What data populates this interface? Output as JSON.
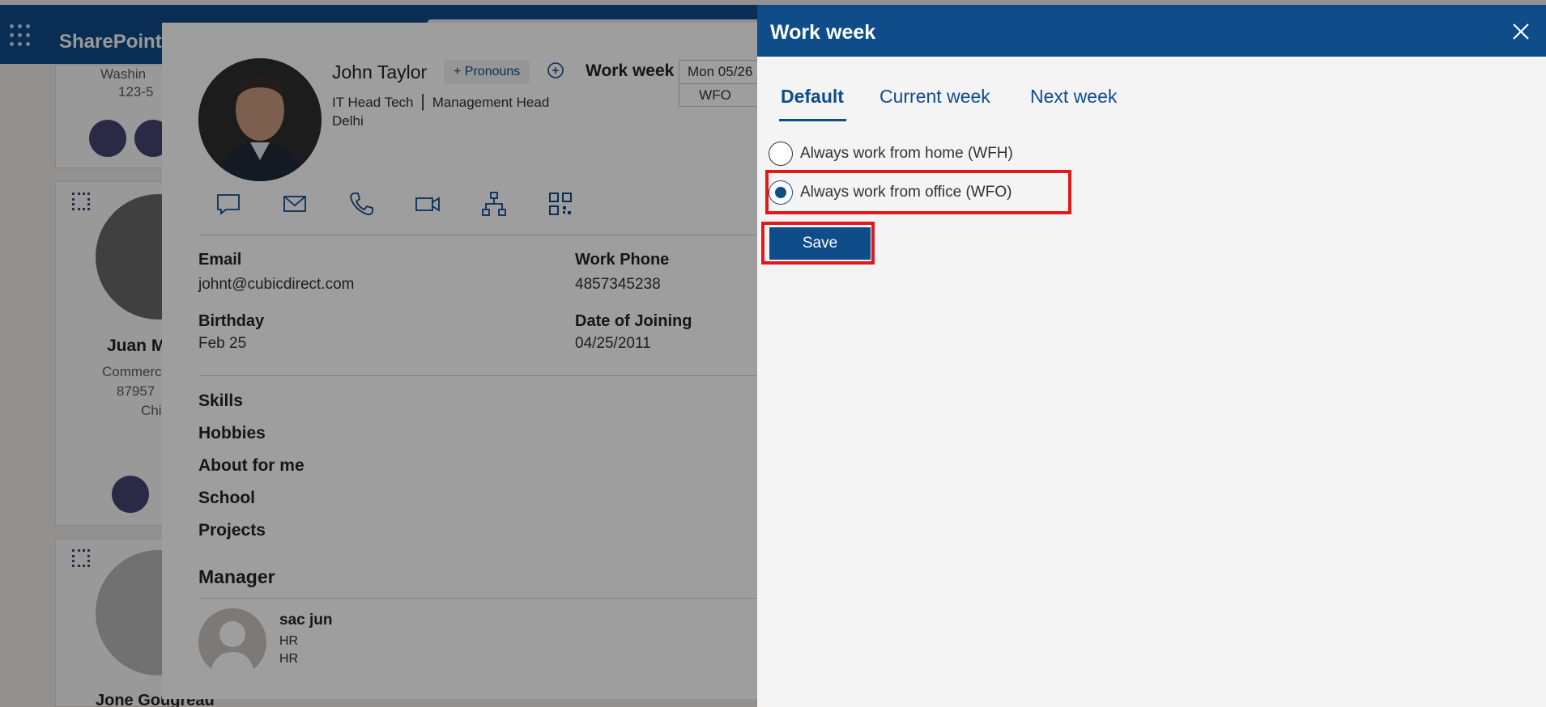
{
  "topbar": {
    "brand": "SharePoint"
  },
  "background_cards": {
    "card1": {
      "location": "Washin",
      "phone": "123-5"
    },
    "card2": {
      "name": "Juan M",
      "dept": "Commerc",
      "phone": "87957",
      "location": "Chi"
    },
    "card3": {
      "name": "Jone Gougreau"
    }
  },
  "profile": {
    "name": "John Taylor",
    "pronouns_button": "+ Pronouns",
    "work_week_label": "Work week",
    "work_week_day": "Mon 05/26",
    "work_week_value": "WFO",
    "title": "IT Head Tech",
    "department": "Management Head",
    "location": "Delhi",
    "email_label": "Email",
    "email": "johnt@cubicdirect.com",
    "work_phone_label": "Work Phone",
    "work_phone": "4857345238",
    "birthday_label": "Birthday",
    "birthday": "Feb 25",
    "joining_label": "Date of Joining",
    "joining": "04/25/2011",
    "sections": [
      "Skills",
      "Hobbies",
      "About for me",
      "School",
      "Projects"
    ],
    "manager_title": "Manager",
    "manager": {
      "name": "sac jun",
      "line1": "HR",
      "line2": "HR"
    }
  },
  "panel": {
    "title": "Work week",
    "tabs": [
      "Default",
      "Current week",
      "Next week"
    ],
    "active_tab": "Default",
    "options": [
      {
        "label": "Always work from home (WFH)",
        "checked": false
      },
      {
        "label": "Always work from office (WFO)",
        "checked": true
      }
    ],
    "save_label": "Save"
  },
  "colors": {
    "brand": "#0f4c8a",
    "highlight": "#e11919"
  }
}
